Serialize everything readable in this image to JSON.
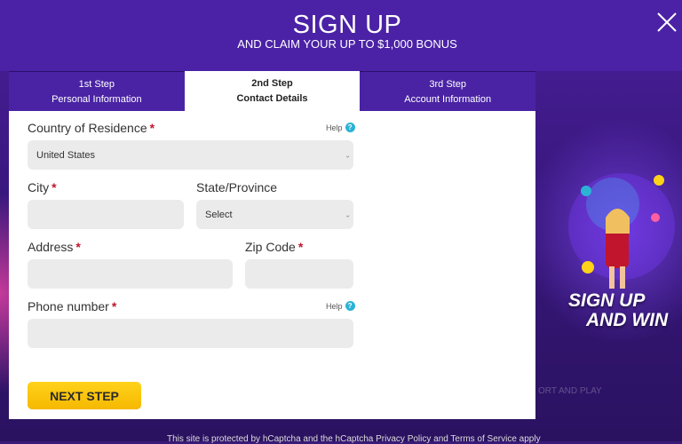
{
  "header": {
    "title": "SIGN UP",
    "subtitle": "AND CLAIM YOUR UP TO $1,000 BONUS"
  },
  "steps": [
    {
      "line1": "1st Step",
      "line2": "Personal Information"
    },
    {
      "line1": "2nd Step",
      "line2": "Contact Details"
    },
    {
      "line1": "3rd Step",
      "line2": "Account Information"
    }
  ],
  "form": {
    "country_label": "Country of Residence",
    "country_value": "United States",
    "city_label": "City",
    "state_label": "State/Province",
    "state_value": "Select",
    "address_label": "Address",
    "zip_label": "Zip Code",
    "phone_label": "Phone number",
    "required_mark": "*",
    "help_label": "Help",
    "help_icon": "?",
    "next_label": "NEXT STEP"
  },
  "promo": {
    "line1": "SIGN UP",
    "line2": "AND WIN",
    "sub": "ORT AND PLAY"
  },
  "footer": "This site is protected by hCaptcha and the hCaptcha Privacy Policy and Terms of Service apply",
  "colors": {
    "accent_purple": "#4b22a6",
    "required_red": "#c0152d",
    "button_yellow": "#ffd21a",
    "help_blue": "#2bb3d6"
  }
}
